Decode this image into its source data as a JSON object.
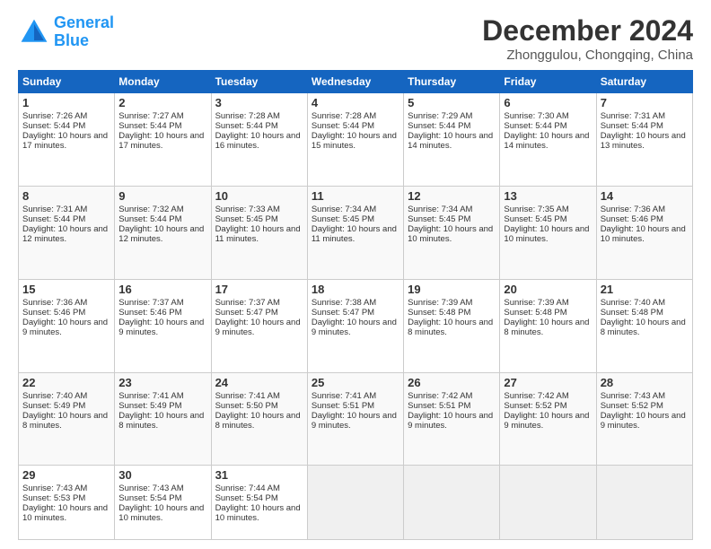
{
  "header": {
    "logo_line1": "General",
    "logo_line2": "Blue",
    "month": "December 2024",
    "location": "Zhonggulou, Chongqing, China"
  },
  "weekdays": [
    "Sunday",
    "Monday",
    "Tuesday",
    "Wednesday",
    "Thursday",
    "Friday",
    "Saturday"
  ],
  "weeks": [
    [
      {
        "day": "1",
        "sunrise": "Sunrise: 7:26 AM",
        "sunset": "Sunset: 5:44 PM",
        "daylight": "Daylight: 10 hours and 17 minutes."
      },
      {
        "day": "2",
        "sunrise": "Sunrise: 7:27 AM",
        "sunset": "Sunset: 5:44 PM",
        "daylight": "Daylight: 10 hours and 17 minutes."
      },
      {
        "day": "3",
        "sunrise": "Sunrise: 7:28 AM",
        "sunset": "Sunset: 5:44 PM",
        "daylight": "Daylight: 10 hours and 16 minutes."
      },
      {
        "day": "4",
        "sunrise": "Sunrise: 7:28 AM",
        "sunset": "Sunset: 5:44 PM",
        "daylight": "Daylight: 10 hours and 15 minutes."
      },
      {
        "day": "5",
        "sunrise": "Sunrise: 7:29 AM",
        "sunset": "Sunset: 5:44 PM",
        "daylight": "Daylight: 10 hours and 14 minutes."
      },
      {
        "day": "6",
        "sunrise": "Sunrise: 7:30 AM",
        "sunset": "Sunset: 5:44 PM",
        "daylight": "Daylight: 10 hours and 14 minutes."
      },
      {
        "day": "7",
        "sunrise": "Sunrise: 7:31 AM",
        "sunset": "Sunset: 5:44 PM",
        "daylight": "Daylight: 10 hours and 13 minutes."
      }
    ],
    [
      {
        "day": "8",
        "sunrise": "Sunrise: 7:31 AM",
        "sunset": "Sunset: 5:44 PM",
        "daylight": "Daylight: 10 hours and 12 minutes."
      },
      {
        "day": "9",
        "sunrise": "Sunrise: 7:32 AM",
        "sunset": "Sunset: 5:44 PM",
        "daylight": "Daylight: 10 hours and 12 minutes."
      },
      {
        "day": "10",
        "sunrise": "Sunrise: 7:33 AM",
        "sunset": "Sunset: 5:45 PM",
        "daylight": "Daylight: 10 hours and 11 minutes."
      },
      {
        "day": "11",
        "sunrise": "Sunrise: 7:34 AM",
        "sunset": "Sunset: 5:45 PM",
        "daylight": "Daylight: 10 hours and 11 minutes."
      },
      {
        "day": "12",
        "sunrise": "Sunrise: 7:34 AM",
        "sunset": "Sunset: 5:45 PM",
        "daylight": "Daylight: 10 hours and 10 minutes."
      },
      {
        "day": "13",
        "sunrise": "Sunrise: 7:35 AM",
        "sunset": "Sunset: 5:45 PM",
        "daylight": "Daylight: 10 hours and 10 minutes."
      },
      {
        "day": "14",
        "sunrise": "Sunrise: 7:36 AM",
        "sunset": "Sunset: 5:46 PM",
        "daylight": "Daylight: 10 hours and 10 minutes."
      }
    ],
    [
      {
        "day": "15",
        "sunrise": "Sunrise: 7:36 AM",
        "sunset": "Sunset: 5:46 PM",
        "daylight": "Daylight: 10 hours and 9 minutes."
      },
      {
        "day": "16",
        "sunrise": "Sunrise: 7:37 AM",
        "sunset": "Sunset: 5:46 PM",
        "daylight": "Daylight: 10 hours and 9 minutes."
      },
      {
        "day": "17",
        "sunrise": "Sunrise: 7:37 AM",
        "sunset": "Sunset: 5:47 PM",
        "daylight": "Daylight: 10 hours and 9 minutes."
      },
      {
        "day": "18",
        "sunrise": "Sunrise: 7:38 AM",
        "sunset": "Sunset: 5:47 PM",
        "daylight": "Daylight: 10 hours and 9 minutes."
      },
      {
        "day": "19",
        "sunrise": "Sunrise: 7:39 AM",
        "sunset": "Sunset: 5:48 PM",
        "daylight": "Daylight: 10 hours and 8 minutes."
      },
      {
        "day": "20",
        "sunrise": "Sunrise: 7:39 AM",
        "sunset": "Sunset: 5:48 PM",
        "daylight": "Daylight: 10 hours and 8 minutes."
      },
      {
        "day": "21",
        "sunrise": "Sunrise: 7:40 AM",
        "sunset": "Sunset: 5:48 PM",
        "daylight": "Daylight: 10 hours and 8 minutes."
      }
    ],
    [
      {
        "day": "22",
        "sunrise": "Sunrise: 7:40 AM",
        "sunset": "Sunset: 5:49 PM",
        "daylight": "Daylight: 10 hours and 8 minutes."
      },
      {
        "day": "23",
        "sunrise": "Sunrise: 7:41 AM",
        "sunset": "Sunset: 5:49 PM",
        "daylight": "Daylight: 10 hours and 8 minutes."
      },
      {
        "day": "24",
        "sunrise": "Sunrise: 7:41 AM",
        "sunset": "Sunset: 5:50 PM",
        "daylight": "Daylight: 10 hours and 8 minutes."
      },
      {
        "day": "25",
        "sunrise": "Sunrise: 7:41 AM",
        "sunset": "Sunset: 5:51 PM",
        "daylight": "Daylight: 10 hours and 9 minutes."
      },
      {
        "day": "26",
        "sunrise": "Sunrise: 7:42 AM",
        "sunset": "Sunset: 5:51 PM",
        "daylight": "Daylight: 10 hours and 9 minutes."
      },
      {
        "day": "27",
        "sunrise": "Sunrise: 7:42 AM",
        "sunset": "Sunset: 5:52 PM",
        "daylight": "Daylight: 10 hours and 9 minutes."
      },
      {
        "day": "28",
        "sunrise": "Sunrise: 7:43 AM",
        "sunset": "Sunset: 5:52 PM",
        "daylight": "Daylight: 10 hours and 9 minutes."
      }
    ],
    [
      {
        "day": "29",
        "sunrise": "Sunrise: 7:43 AM",
        "sunset": "Sunset: 5:53 PM",
        "daylight": "Daylight: 10 hours and 10 minutes."
      },
      {
        "day": "30",
        "sunrise": "Sunrise: 7:43 AM",
        "sunset": "Sunset: 5:54 PM",
        "daylight": "Daylight: 10 hours and 10 minutes."
      },
      {
        "day": "31",
        "sunrise": "Sunrise: 7:44 AM",
        "sunset": "Sunset: 5:54 PM",
        "daylight": "Daylight: 10 hours and 10 minutes."
      },
      null,
      null,
      null,
      null
    ]
  ]
}
